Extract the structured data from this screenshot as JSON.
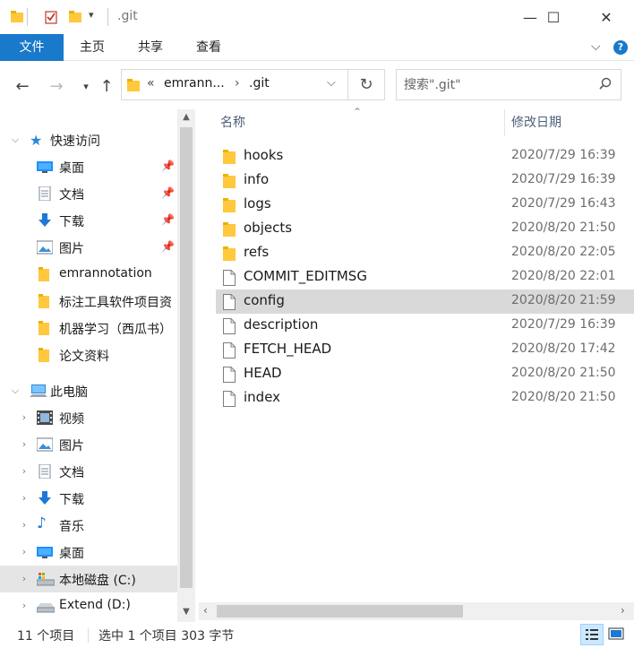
{
  "window": {
    "title": ".git",
    "minimize_glyph": "—",
    "maximize_glyph": "☐",
    "close_glyph": "✕"
  },
  "ribbon": {
    "tabs": [
      {
        "label": "文件"
      },
      {
        "label": "主页"
      },
      {
        "label": "共享"
      },
      {
        "label": "查看"
      }
    ]
  },
  "address": {
    "overflow": "«",
    "crumbs": [
      {
        "label": "emrann..."
      },
      {
        "label": ".git"
      }
    ],
    "separator": "›"
  },
  "search": {
    "placeholder": "搜索\".git\""
  },
  "nav": {
    "quick_access": {
      "label": "快速访问",
      "items": [
        {
          "label": "桌面",
          "icon": "desktop-icon",
          "pinned": true
        },
        {
          "label": "文档",
          "icon": "document-icon",
          "pinned": true
        },
        {
          "label": "下载",
          "icon": "download-icon",
          "pinned": true
        },
        {
          "label": "图片",
          "icon": "picture-icon",
          "pinned": true
        },
        {
          "label": "emrannotation",
          "icon": "folder-icon",
          "pinned": false
        },
        {
          "label": "标注工具软件项目资",
          "icon": "folder-icon",
          "pinned": false
        },
        {
          "label": "机器学习（西瓜书）",
          "icon": "folder-icon",
          "pinned": false
        },
        {
          "label": "论文资料",
          "icon": "folder-icon",
          "pinned": false
        }
      ]
    },
    "this_pc": {
      "label": "此电脑",
      "items": [
        {
          "label": "视频",
          "icon": "video-icon"
        },
        {
          "label": "图片",
          "icon": "picture-icon"
        },
        {
          "label": "文档",
          "icon": "document-icon"
        },
        {
          "label": "下载",
          "icon": "download-icon"
        },
        {
          "label": "音乐",
          "icon": "music-icon"
        },
        {
          "label": "桌面",
          "icon": "desktop-icon"
        },
        {
          "label": "本地磁盘 (C:)",
          "icon": "local-disk-icon"
        },
        {
          "label": "Extend (D:)",
          "icon": "drive-icon"
        }
      ]
    }
  },
  "columns": {
    "name": "名称",
    "modified": "修改日期"
  },
  "files": [
    {
      "name": "hooks",
      "date": "2020/7/29 16:39",
      "type": "folder"
    },
    {
      "name": "info",
      "date": "2020/7/29 16:39",
      "type": "folder"
    },
    {
      "name": "logs",
      "date": "2020/7/29 16:43",
      "type": "folder"
    },
    {
      "name": "objects",
      "date": "2020/8/20 21:50",
      "type": "folder"
    },
    {
      "name": "refs",
      "date": "2020/8/20 22:05",
      "type": "folder"
    },
    {
      "name": "COMMIT_EDITMSG",
      "date": "2020/8/20 22:01",
      "type": "file"
    },
    {
      "name": "config",
      "date": "2020/8/20 21:59",
      "type": "file",
      "selected": true
    },
    {
      "name": "description",
      "date": "2020/7/29 16:39",
      "type": "file"
    },
    {
      "name": "FETCH_HEAD",
      "date": "2020/8/20 17:42",
      "type": "file"
    },
    {
      "name": "HEAD",
      "date": "2020/8/20 21:50",
      "type": "file"
    },
    {
      "name": "index",
      "date": "2020/8/20 21:50",
      "type": "file"
    }
  ],
  "status": {
    "count": "11 个项目",
    "selection": "选中 1 个项目  303 字节"
  },
  "colors": {
    "accent": "#1979ca",
    "selection": "#d9d9d9",
    "folder": "#ffc83d"
  }
}
